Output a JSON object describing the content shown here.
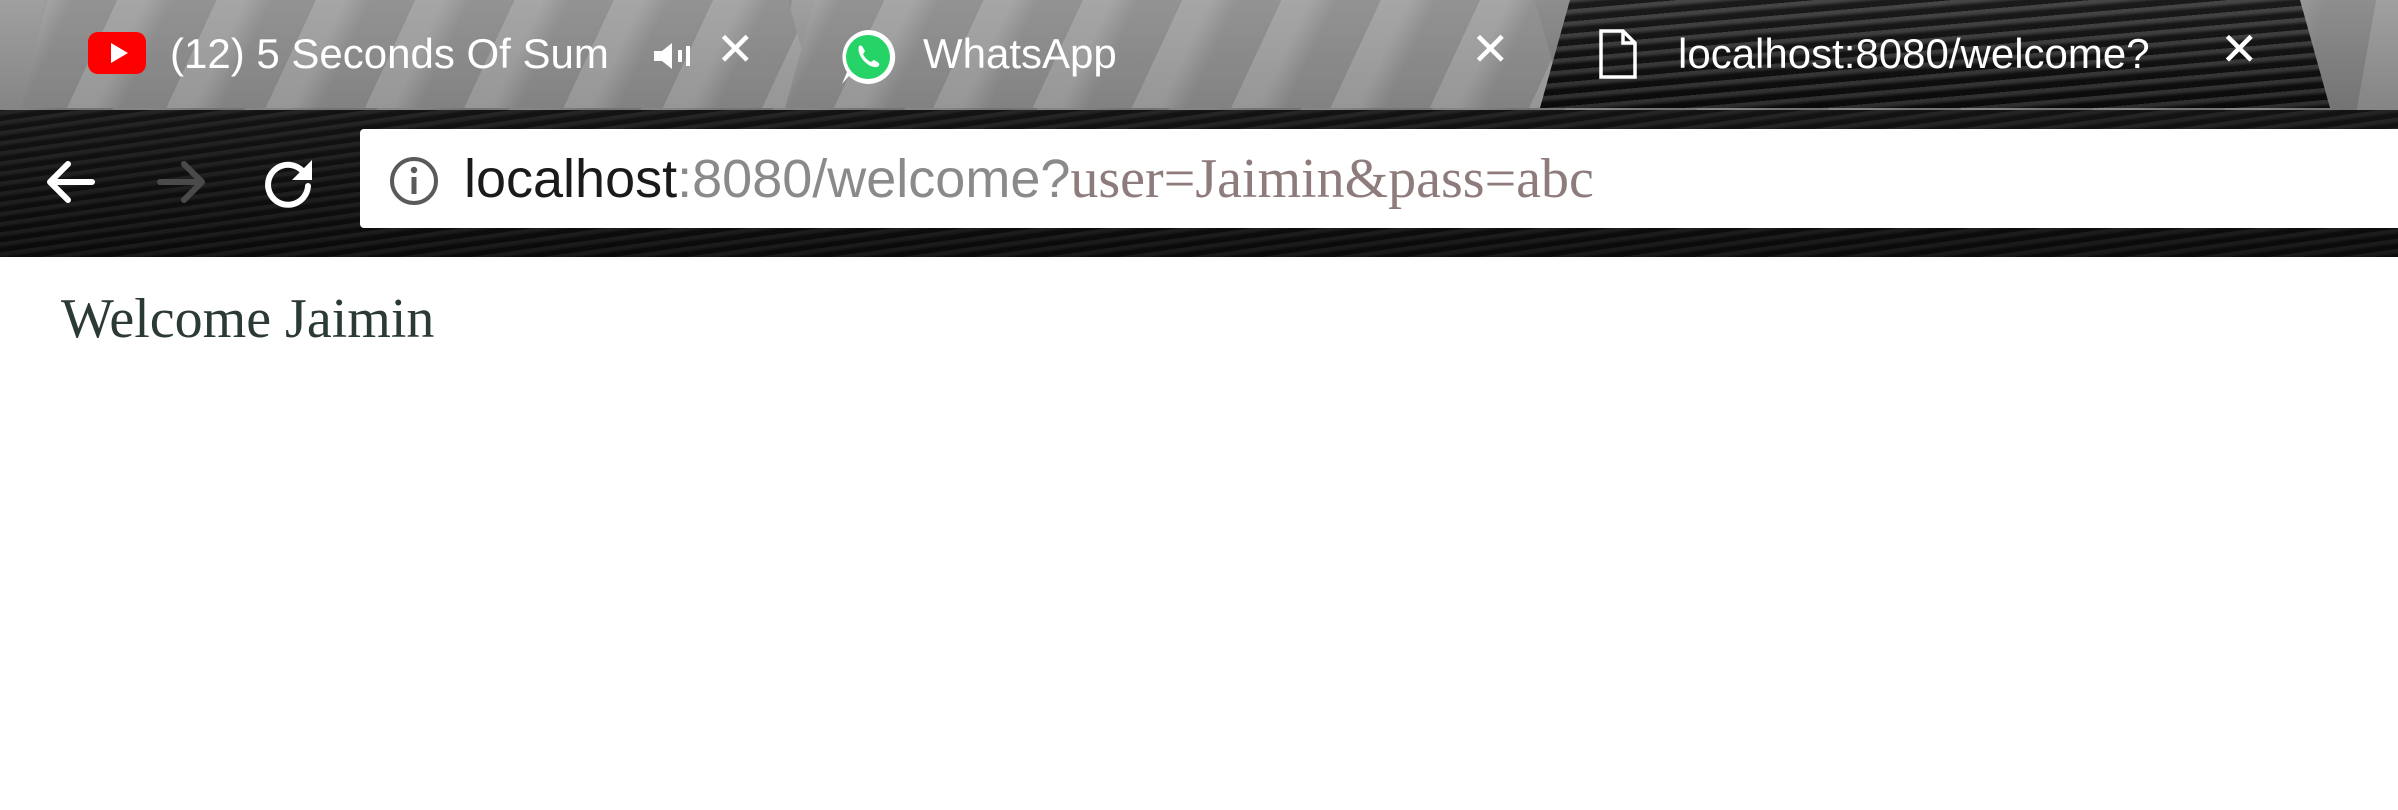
{
  "tabs": [
    {
      "title": "(12) 5 Seconds Of Sum",
      "icon": "youtube-icon",
      "audio_icon": "speaker-icon",
      "close_label": "✕",
      "active": false
    },
    {
      "title": "WhatsApp",
      "icon": "whatsapp-icon",
      "close_label": "✕",
      "active": false
    },
    {
      "title": "localhost:8080/welcome?",
      "icon": "page-icon",
      "close_label": "✕",
      "active": true
    }
  ],
  "toolbar": {
    "back_icon": "back-arrow-icon",
    "forward_icon": "forward-arrow-icon",
    "reload_icon": "reload-icon"
  },
  "omnibox": {
    "info_icon": "info-icon",
    "url_host": "localhost",
    "url_port_path": ":8080/welcome?",
    "url_query": "user=Jaimin&pass=abc"
  },
  "page": {
    "welcome_text": "Welcome Jaimin"
  },
  "colors": {
    "youtube_red": "#ff0000",
    "whatsapp_green": "#25d366",
    "page_text": "#2b3a35"
  }
}
